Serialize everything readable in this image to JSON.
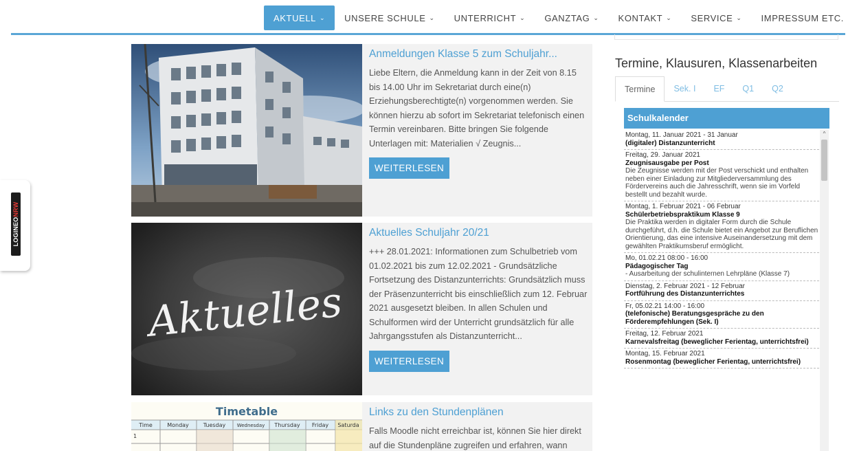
{
  "nav": {
    "items": [
      {
        "label": "AKTUELL"
      },
      {
        "label": "UNSERE SCHULE"
      },
      {
        "label": "UNTERRICHT"
      },
      {
        "label": "GANZTAG"
      },
      {
        "label": "KONTAKT"
      },
      {
        "label": "SERVICE"
      },
      {
        "label": "IMPRESSUM ETC."
      }
    ],
    "chevron": "⌄"
  },
  "side_tab": {
    "logo_main": "LOGINEO",
    "logo_accent": "NRW"
  },
  "news": [
    {
      "title": "Anmeldungen Klasse 5 zum Schuljahr...",
      "excerpt": "Liebe Eltern, die Anmeldung kann in der Zeit von 8.15 bis 14.00 Uhr im Sekretariat durch eine(n) Erziehungsberechtigte(n) vorgenommen werden. Sie können hierzu ab sofort im Sekretariat telefonisch einen Termin vereinbaren. Bitte bringen Sie folgende Unterlagen mit: Materialien √ Zeugnis...",
      "button": "WEITERLESEN"
    },
    {
      "title": "Aktuelles Schuljahr 20/21",
      "excerpt": "+++ 28.01.2021: Informationen zum Schulbetrieb vom 01.02.2021 bis zum 12.02.2021 - Grundsätzliche Fortsetzung des Distanzunterrichts: Grundsätzlich muss der Präsenzunterricht bis einschließlich zum 12. Februar 2021 ausgesetzt bleiben. In allen Schulen und Schulformen wird der Unterricht grundsätzlich für alle Jahrgangsstufen als Distanzunterricht...",
      "button": "WEITERLESEN",
      "image_text": "Aktuelles"
    },
    {
      "title": "Links zu den Stundenplänen",
      "excerpt": "Falls Moodle nicht erreichbar ist, können Sie hier direkt auf die Stundenpläne zugreifen und erfahren, wann",
      "image": {
        "title": "Timetable",
        "days": [
          "Time",
          "Monday",
          "Tuesday",
          "Wednesday",
          "Thursday",
          "Friday",
          "Saturda"
        ],
        "row_label": "1"
      }
    }
  ],
  "sidebar": {
    "title": "Termine, Klausuren, Klassenarbeiten",
    "tabs": [
      {
        "label": "Termine"
      },
      {
        "label": "Sek. I"
      },
      {
        "label": "EF"
      },
      {
        "label": "Q1"
      },
      {
        "label": "Q2"
      }
    ],
    "calendar_title": "Schulkalender",
    "events": [
      {
        "date": "Montag, 11. Januar 2021 - 31 Januar",
        "title": "(digitaler) Distanzunterricht",
        "desc": ""
      },
      {
        "date": "Freitag, 29. Januar 2021",
        "title": "Zeugnisausgabe per Post",
        "desc": "Die Zeugnisse werden mit der Post verschickt und enthalten neben einer Einladung zur Mitgliederversammlung des Fördervereins auch die Jahresschrift, wenn sie im Vorfeld bestellt und bezahlt wurde."
      },
      {
        "date": "Montag, 1. Februar 2021 - 06 Februar",
        "title": "Schülerbetriebspraktikum Klasse 9",
        "desc": "Die Praktika werden in digitaler Form durch die Schule durchgeführt, d.h. die Schule bietet ein Angebot zur Beruflichen Orientierung, das eine intensive Auseinandersetzung mit dem gewählten Praktikumsberuf ermöglicht."
      },
      {
        "date": "Mo, 01.02.21 08:00 - 16:00",
        "title": "Pädagogischer Tag",
        "desc": "- Ausarbeitung der schulinternen Lehrpläne (Klasse 7)"
      },
      {
        "date": "Dienstag, 2. Februar 2021 - 12 Februar",
        "title": "Fortführung des Distanzunterrichtes",
        "desc": ""
      },
      {
        "date": "Fr, 05.02.21 14:00 - 16:00",
        "title": "(telefonische) Beratungsgespräche zu den Förderempfehlungen (Sek. I)",
        "desc": ""
      },
      {
        "date": "Freitag, 12. Februar 2021",
        "title": "Karnevalsfreitag (beweglicher Ferientag, unterrichtsfrei)",
        "desc": ""
      },
      {
        "date": "Montag, 15. Februar 2021",
        "title": "Rosenmontag (beweglicher Ferientag, unterrichtsfrei)",
        "desc": ""
      }
    ],
    "scroll_up": "^"
  }
}
